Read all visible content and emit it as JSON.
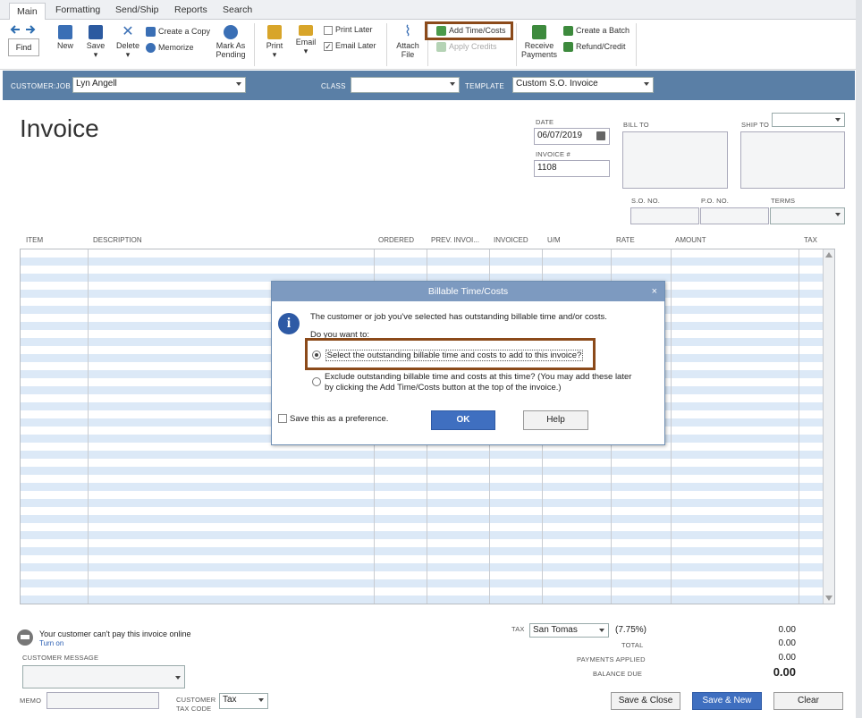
{
  "tabs": [
    "Main",
    "Formatting",
    "Send/Ship",
    "Reports",
    "Search"
  ],
  "ribbon": {
    "find": "Find",
    "new": "New",
    "save": "Save",
    "delete": "Delete",
    "create_copy": "Create a Copy",
    "memorize": "Memorize",
    "mark_as_pending_1": "Mark As",
    "mark_as_pending_2": "Pending",
    "print": "Print",
    "email": "Email",
    "print_later": "Print Later",
    "email_later": "Email Later",
    "attach_file_1": "Attach",
    "attach_file_2": "File",
    "add_time_costs": "Add Time/Costs",
    "apply_credits": "Apply Credits",
    "receive_payments_1": "Receive",
    "receive_payments_2": "Payments",
    "create_batch": "Create a Batch",
    "refund_credit": "Refund/Credit"
  },
  "header_bar": {
    "customer_job_label": "CUSTOMER:JOB",
    "customer_job_value": "Lyn Angell",
    "class_label": "CLASS",
    "class_value": "",
    "template_label": "TEMPLATE",
    "template_value": "Custom S.O. Invoice"
  },
  "form": {
    "title": "Invoice",
    "date_label": "DATE",
    "date_value": "06/07/2019",
    "invoice_no_label": "INVOICE #",
    "invoice_no_value": "1108",
    "bill_to_label": "BILL TO",
    "ship_to_label": "SHIP TO",
    "so_no_label": "S.O. NO.",
    "po_no_label": "P.O. NO.",
    "terms_label": "TERMS"
  },
  "columns": [
    "ITEM",
    "DESCRIPTION",
    "ORDERED",
    "PREV. INVOI...",
    "INVOICED",
    "U/M",
    "RATE",
    "AMOUNT",
    "TAX"
  ],
  "dialog": {
    "title": "Billable Time/Costs",
    "close": "×",
    "message": "The customer or job you've selected has outstanding billable time and/or costs.",
    "prompt": "Do you want to:",
    "option1": "Select the outstanding billable time and costs to add to this invoice?",
    "option2_line1": "Exclude outstanding billable time and costs at this time? (You may add these later",
    "option2_line2": "by clicking the Add Time/Costs button at the top of the invoice.)",
    "save_pref": "Save this as a preference.",
    "ok": "OK",
    "help": "Help"
  },
  "footer": {
    "online_msg": "Your customer can't pay this invoice online",
    "turn_on": "Turn on",
    "customer_message_label": "CUSTOMER MESSAGE",
    "memo_label": "MEMO",
    "customer_tax_code_label_1": "CUSTOMER",
    "customer_tax_code_label_2": "TAX CODE",
    "tax_code_value": "Tax",
    "tax_label": "TAX",
    "tax_item": "San Tomas",
    "tax_rate": "(7.75%)",
    "tax_amount": "0.00",
    "total_label": "TOTAL",
    "total_value": "0.00",
    "payments_label": "PAYMENTS APPLIED",
    "payments_value": "0.00",
    "balance_label": "BALANCE DUE",
    "balance_value": "0.00",
    "save_close": "Save & Close",
    "save_new": "Save & New",
    "clear": "Clear"
  }
}
